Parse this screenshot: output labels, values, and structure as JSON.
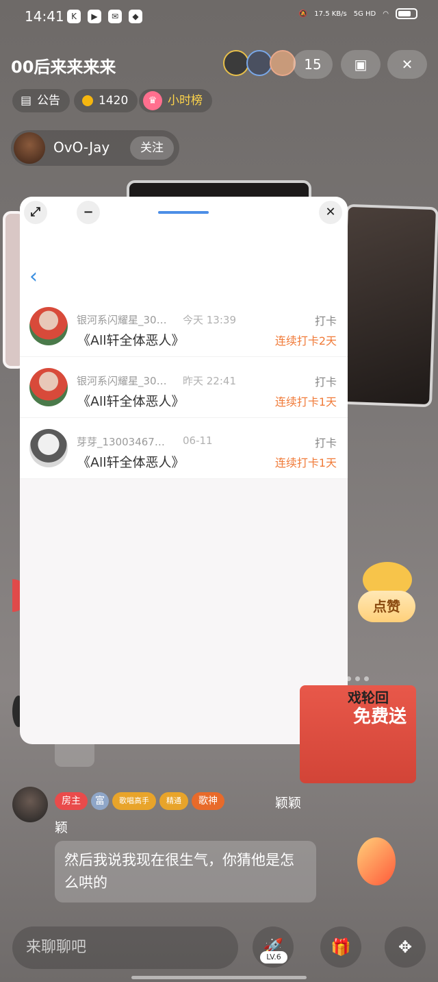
{
  "status_bar": {
    "time": "14:41",
    "net_speed": "17.5\nKB/s",
    "network": "5G HD"
  },
  "header": {
    "room_title": "00后来来来来",
    "viewer_count": "15"
  },
  "chips": {
    "notice": "公告",
    "coins": "1420",
    "hour_rank": "小时榜"
  },
  "host": {
    "name": "OvO-Jay",
    "follow": "关注"
  },
  "modal": {
    "rows": [
      {
        "user": "银河系闪耀星_30…",
        "time": "今天 13:39",
        "type": "打卡",
        "book": "《All轩全体恶人》",
        "streak": "连续打卡2天"
      },
      {
        "user": "银河系闪耀星_30…",
        "time": "昨天 22:41",
        "type": "打卡",
        "book": "《All轩全体恶人》",
        "streak": "连续打卡1天"
      },
      {
        "user": "芽芽_13003467…",
        "time": "06-11",
        "type": "打卡",
        "book": "《All轩全体恶人》",
        "streak": "连续打卡1天"
      }
    ]
  },
  "widgets": {
    "like": "点赞",
    "promo_line1": "戏轮回",
    "promo_line2": "免费送"
  },
  "chat": {
    "badges": [
      "房主",
      "富",
      "歌唱高手",
      "精通",
      "歌神"
    ],
    "name_part1": "颖颖",
    "name_part2": "颖",
    "message": "然后我说我现在很生气，你猜他是怎么哄的"
  },
  "bottom": {
    "input_placeholder": "来聊聊吧",
    "level": "LV.6"
  },
  "colors": {
    "accent_blue": "#4c8ee6",
    "streak_orange": "#f07a38",
    "host_badge": "#e94b4b"
  }
}
